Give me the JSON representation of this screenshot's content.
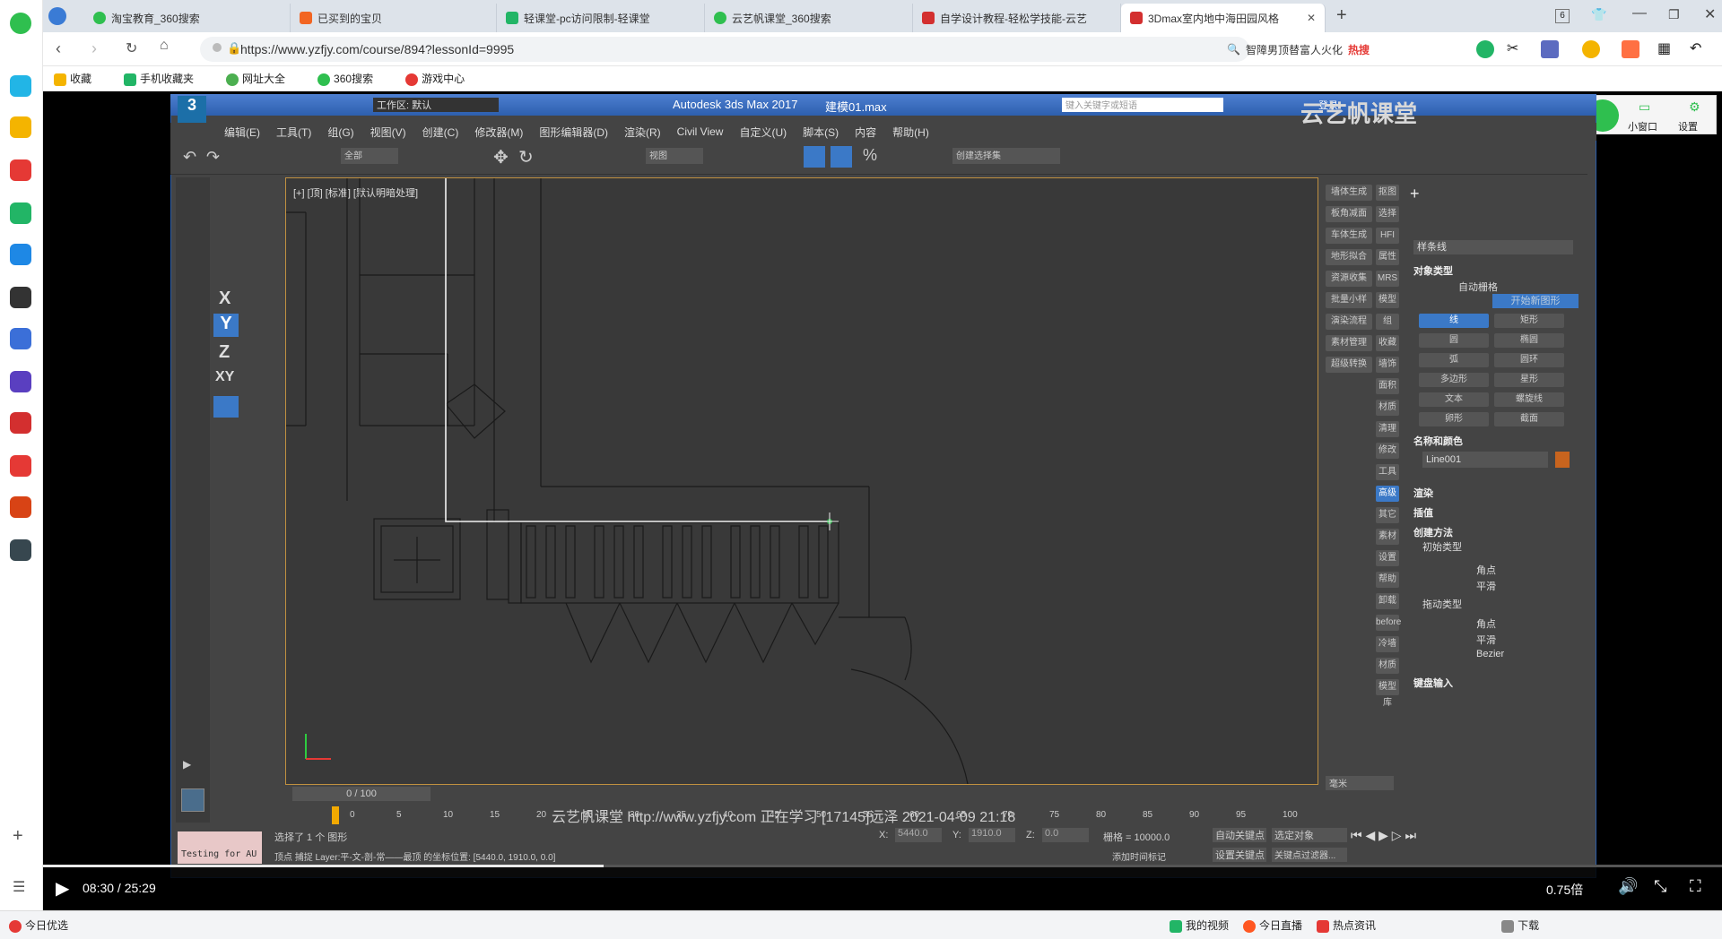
{
  "browser": {
    "tabs": [
      {
        "label": "淘宝教育_360搜索"
      },
      {
        "label": "已买到的宝贝"
      },
      {
        "label": "轻课堂-pc访问限制-轻课堂"
      },
      {
        "label": "云艺帆课堂_360搜索"
      },
      {
        "label": "自学设计教程-轻松学技能-云艺"
      },
      {
        "label": "3Dmax室内地中海田园风格"
      }
    ],
    "tab_count": "6",
    "url": "https://www.yzfjy.com/course/894?lessonId=9995",
    "search_text": "智障男顶替富人火化",
    "search_badge": "热搜",
    "bookmarks": [
      "收藏",
      "手机收藏夹",
      "网址大全",
      "360搜索",
      "游戏中心"
    ]
  },
  "max": {
    "title": "Autodesk 3ds Max 2017",
    "file": "建模01.max",
    "workspace": "工作区: 默认",
    "search_placeholder": "键入关键字或短语",
    "login": "登录",
    "menu": [
      "编辑(E)",
      "工具(T)",
      "组(G)",
      "视图(V)",
      "创建(C)",
      "修改器(M)",
      "图形编辑器(D)",
      "渲染(R)",
      "Civil View",
      "自定义(U)",
      "脚本(S)",
      "内容",
      "帮助(H)"
    ],
    "toolbar": {
      "filter": "全部",
      "view": "视图",
      "selection_set": "创建选择集"
    },
    "viewport_label": "[+] [顶] [标准] [默认明暗处理]",
    "brand": "云艺帆课堂",
    "right_panel": {
      "dropdown": "样条线",
      "section_object_type": "对象类型",
      "auto_grid": "自动栅格",
      "start_new_shape": "开始新图形",
      "object_buttons": [
        "线",
        "矩形",
        "圆",
        "椭圆",
        "弧",
        "圆环",
        "多边形",
        "星形",
        "文本",
        "螺旋线",
        "卵形",
        "截面"
      ],
      "section_name_color": "名称和颜色",
      "object_name": "Line001",
      "section_render": "渲染",
      "section_interp": "插值",
      "section_creation": "创建方法",
      "initial_type": "初始类型",
      "initial_options": [
        "角点",
        "平滑"
      ],
      "drag_type": "拖动类型",
      "drag_options": [
        "角点",
        "平滑",
        "Bezier"
      ],
      "section_keyboard": "键盘输入"
    },
    "plugin_buttons": [
      "墙体生成",
      "板角减面",
      "车体生成",
      "地形拟合",
      "资源收集",
      "批量小样",
      "演染流程",
      "素材管理",
      "超级转换"
    ],
    "plugin_short": [
      "抠图",
      "选择",
      "HFI",
      "属性",
      "MRS",
      "模型",
      "组",
      "收藏",
      "墙饰",
      "面积",
      "材质",
      "清理",
      "修改",
      "工具",
      "高级",
      "其它",
      "素材",
      "设置",
      "帮助",
      "卸载",
      "before",
      "冷墙",
      "材质",
      "模型库"
    ],
    "timeline": {
      "frame": "0 / 100",
      "ticks": [
        "0",
        "5",
        "10",
        "15",
        "20",
        "25",
        "30",
        "35",
        "40",
        "45",
        "50",
        "55",
        "60",
        "65",
        "70",
        "75",
        "80",
        "85",
        "90",
        "95",
        "100"
      ]
    },
    "status": {
      "selected": "选择了 1 个 图形",
      "hint": "顶点 捕捉 Layer:平-文-剖-常——最顶 的坐标位置: [5440.0, 1910.0, 0.0]",
      "x": "5440.0",
      "y": "1910.0",
      "z": "0.0",
      "grid": "栅格 = 10000.0",
      "auto_key": "自动关键点",
      "select_obj": "选定对象",
      "set_key": "设置关键点",
      "key_filter": "关键点过滤器...",
      "add_time_tag": "添加时间标记",
      "unit": "毫米",
      "script_label": "Testing for AU"
    }
  },
  "watermark": "云艺帆课堂 http://www.yzfjy.com 正在学习 [17145]远泽 2021-04-09 21:18",
  "player": {
    "time": "08:30 / 25:29",
    "speed": "0.75倍",
    "progress": 0.334
  },
  "top_right": {
    "mini": "小窗口",
    "settings": "设置"
  },
  "bottom": {
    "left": "今日优选",
    "items": [
      "我的视频",
      "今日直播",
      "热点资讯",
      "下载"
    ]
  }
}
